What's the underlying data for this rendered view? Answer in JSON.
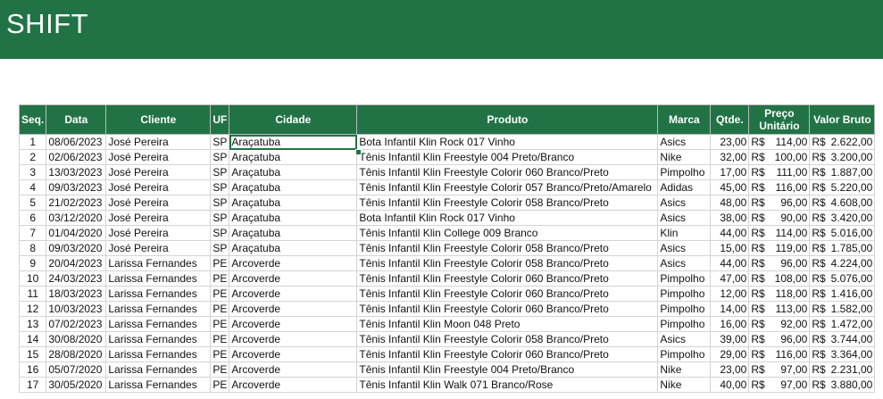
{
  "banner": {
    "title": "SHIFT"
  },
  "colors": {
    "header_bg": "#217346",
    "header_text": "#ffffff",
    "grid_line": "#d4d4d4"
  },
  "table": {
    "headers": [
      "Seq.",
      "Data",
      "Cliente",
      "UF",
      "Cidade",
      "Produto",
      "Marca",
      "Qtde.",
      "Preço Unitário",
      "Valor Bruto"
    ],
    "currency": "R$",
    "rows": [
      [
        "1",
        "08/06/2023",
        "José Pereira",
        "SP",
        "Araçatuba",
        "Bota Infantil Klin Rock 017 Vinho",
        "Asics",
        "23,00",
        "114,00",
        "2.622,00"
      ],
      [
        "2",
        "02/06/2023",
        "José Pereira",
        "SP",
        "Araçatuba",
        "Tênis Infantil Klin Freestyle 004 Preto/Branco",
        "Nike",
        "32,00",
        "100,00",
        "3.200,00"
      ],
      [
        "3",
        "13/03/2023",
        "José Pereira",
        "SP",
        "Araçatuba",
        "Tênis Infantil Klin Freestyle Colorir 060 Branco/Preto",
        "Pimpolho",
        "17,00",
        "111,00",
        "1.887,00"
      ],
      [
        "4",
        "09/03/2023",
        "José Pereira",
        "SP",
        "Araçatuba",
        "Tênis Infantil Klin Freestyle Colorir 057 Branco/Preto/Amarelo",
        "Adidas",
        "45,00",
        "116,00",
        "5.220,00"
      ],
      [
        "5",
        "21/02/2023",
        "José Pereira",
        "SP",
        "Araçatuba",
        "Tênis Infantil Klin Freestyle Colorir 058 Branco/Preto",
        "Asics",
        "48,00",
        "96,00",
        "4.608,00"
      ],
      [
        "6",
        "03/12/2020",
        "José Pereira",
        "SP",
        "Araçatuba",
        "Bota Infantil Klin Rock 017 Vinho",
        "Asics",
        "38,00",
        "90,00",
        "3.420,00"
      ],
      [
        "7",
        "01/04/2020",
        "José Pereira",
        "SP",
        "Araçatuba",
        "Tênis Infantil Klin College 009 Branco",
        "Klin",
        "44,00",
        "114,00",
        "5.016,00"
      ],
      [
        "8",
        "09/03/2020",
        "José Pereira",
        "SP",
        "Araçatuba",
        "Tênis Infantil Klin Freestyle Colorir 058 Branco/Preto",
        "Asics",
        "15,00",
        "119,00",
        "1.785,00"
      ],
      [
        "9",
        "20/04/2023",
        "Larissa Fernandes",
        "PE",
        "Arcoverde",
        "Tênis Infantil Klin Freestyle Colorir 058 Branco/Preto",
        "Asics",
        "44,00",
        "96,00",
        "4.224,00"
      ],
      [
        "10",
        "24/03/2023",
        "Larissa Fernandes",
        "PE",
        "Arcoverde",
        "Tênis Infantil Klin Freestyle Colorir 060 Branco/Preto",
        "Pimpolho",
        "47,00",
        "108,00",
        "5.076,00"
      ],
      [
        "11",
        "18/03/2023",
        "Larissa Fernandes",
        "PE",
        "Arcoverde",
        "Tênis Infantil Klin Freestyle Colorir 060 Branco/Preto",
        "Pimpolho",
        "12,00",
        "118,00",
        "1.416,00"
      ],
      [
        "12",
        "10/03/2023",
        "Larissa Fernandes",
        "PE",
        "Arcoverde",
        "Tênis Infantil Klin Freestyle Colorir 060 Branco/Preto",
        "Pimpolho",
        "14,00",
        "113,00",
        "1.582,00"
      ],
      [
        "13",
        "07/02/2023",
        "Larissa Fernandes",
        "PE",
        "Arcoverde",
        "Tênis Infantil Klin Moon 048 Preto",
        "Pimpolho",
        "16,00",
        "92,00",
        "1.472,00"
      ],
      [
        "14",
        "30/08/2020",
        "Larissa Fernandes",
        "PE",
        "Arcoverde",
        "Tênis Infantil Klin Freestyle Colorir 058 Branco/Preto",
        "Asics",
        "39,00",
        "96,00",
        "3.744,00"
      ],
      [
        "15",
        "28/08/2020",
        "Larissa Fernandes",
        "PE",
        "Arcoverde",
        "Tênis Infantil Klin Freestyle Colorir 060 Branco/Preto",
        "Pimpolho",
        "29,00",
        "116,00",
        "3.364,00"
      ],
      [
        "16",
        "05/07/2020",
        "Larissa Fernandes",
        "PE",
        "Arcoverde",
        "Tênis Infantil Klin Freestyle 004 Preto/Branco",
        "Nike",
        "23,00",
        "97,00",
        "2.231,00"
      ],
      [
        "17",
        "30/05/2020",
        "Larissa Fernandes",
        "PE",
        "Arcoverde",
        "Tênis Infantil Klin Walk 071 Branco/Rose",
        "Nike",
        "40,00",
        "97,00",
        "3.880,00"
      ]
    ]
  }
}
